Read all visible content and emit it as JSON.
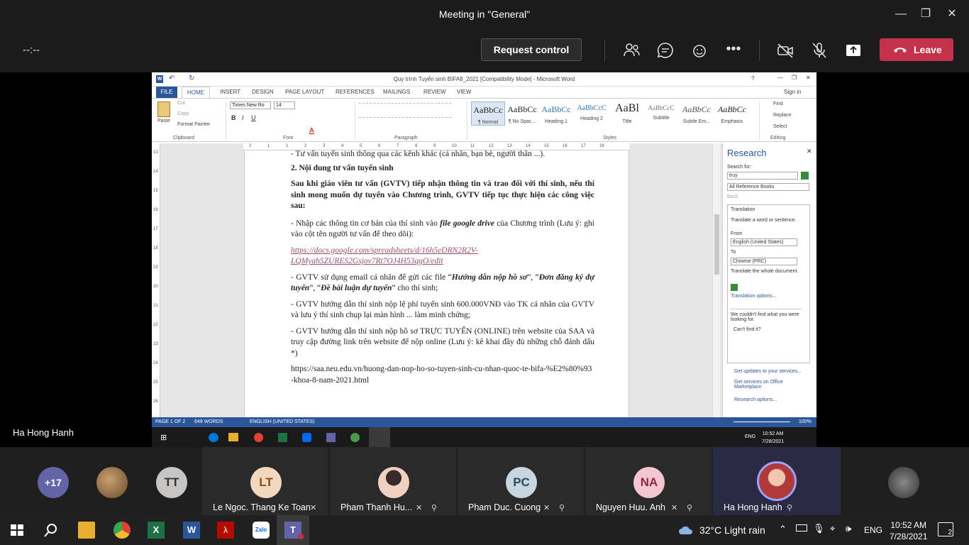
{
  "window": {
    "title": "Meeting in \"General\""
  },
  "toolbar": {
    "timer": "--:--",
    "request_control": "Request control",
    "leave": "Leave"
  },
  "presenter": {
    "name": "Ha Hong Hanh"
  },
  "word": {
    "title": "Quy trình Tuyển sinh BIFA8_2021 [Compatibility Mode] - Microsoft Word",
    "signin": "Sign in",
    "tabs": [
      "FILE",
      "HOME",
      "INSERT",
      "DESIGN",
      "PAGE LAYOUT",
      "REFERENCES",
      "MAILINGS",
      "REVIEW",
      "VIEW"
    ],
    "ribbon": {
      "clipboard": {
        "paste": "Paste",
        "cut": "Cut",
        "copy": "Copy",
        "format_painter": "Format Painter",
        "group": "Clipboard"
      },
      "font": {
        "name": "Times New Ro",
        "size": "14",
        "group": "Font"
      },
      "paragraph": {
        "group": "Paragraph"
      },
      "styles": {
        "group": "Styles",
        "items": [
          {
            "sample": "AaBbCc",
            "name": "¶ Normal"
          },
          {
            "sample": "AaBbCc",
            "name": "¶ No Spac..."
          },
          {
            "sample": "AaBbCc",
            "name": "Heading 1"
          },
          {
            "sample": "AaBbCcC",
            "name": "Heading 2"
          },
          {
            "sample": "AaBl",
            "name": "Title"
          },
          {
            "sample": "AaBbCcC",
            "name": "Subtitle"
          },
          {
            "sample": "AaBbCc",
            "name": "Subtle Em..."
          },
          {
            "sample": "AaBbCc",
            "name": "Emphasis"
          }
        ]
      },
      "editing": {
        "find": "Find",
        "replace": "Replace",
        "select": "Select",
        "group": "Editing"
      }
    },
    "ruler_marks": [
      "2",
      "1",
      "1",
      "2",
      "3",
      "4",
      "5",
      "6",
      "7",
      "8",
      "9",
      "10",
      "11",
      "12",
      "13",
      "14",
      "15",
      "16",
      "17",
      "18"
    ],
    "vruler_marks": [
      "13",
      "14",
      "15",
      "16",
      "17",
      "18",
      "19",
      "20",
      "21",
      "22",
      "23",
      "24",
      "25",
      "26"
    ],
    "doc": {
      "line0": "- Tư vấn tuyển sinh thông qua các kênh khác (cá nhân, bạn bè, người thân ...).",
      "heading": "2. Nội dung tư vấn tuyển sinh",
      "intro": "Sau khi giáo viên tư vấn (GVTV) tiếp nhận thông tin và trao đổi với thí sinh, nếu thí sinh mong muốn dự tuyển vào Chương trình, GVTV tiếp tục thực hiện các công việc sau:",
      "p1a": "- Nhập các thông tin cơ bản của thí sinh vào ",
      "p1b": "file google drive",
      "p1c": " của Chương trình (Lưu ý: ghi vào cột tên người tư vấn để theo dõi):",
      "link1": "https://docs.google.com/spreadsheets/d/16h5eDRN2R2V-LQMyah5ZURES2Gsjov7Rt7OJ4H53qgO/edit",
      "p2a": "- GVTV sử dụng email cá nhân để gửi các file “",
      "p2b": "Hướng dẫn nộp hồ sơ",
      "p2c": "”, “",
      "p2d": "Đơn đăng ký dự tuyển",
      "p2e": "”, “",
      "p2f": "Đề bài luận dự tuyển",
      "p2g": "” cho thí sinh;",
      "p3": "- GVTV hướng dẫn thí sinh nộp lệ phí tuyển sinh 600.000VNĐ vào TK cá nhân của GVTV và lưu ý thí sinh chụp lại màn hình ... làm minh chứng;",
      "p4": "- GVTV hướng dẫn thí sinh nộp hồ sơ TRỰC TUYẾN (ONLINE) trên website của SAA và truy cập đường link trên website để nộp online (Lưu ý: kê khai đầy đủ những chỗ đánh dấu *)",
      "link2": "https://saa.neu.edu.vn/huong-dan-nop-ho-so-tuyen-sinh-cu-nhan-quoc-te-bifa-%E2%80%93-khoa-8-nam-2021.html"
    },
    "research": {
      "title": "Research",
      "search_for": "Search for:",
      "query": "truy",
      "source": "All Reference Books",
      "back": "Back",
      "translation": "Translation",
      "translate_hint": "Translate a word or sentence.",
      "from": "From",
      "from_lang": "English (United States)",
      "to": "To",
      "to_lang": "Chinese (PRC)",
      "translate_doc": "Translate the whole document.",
      "options": "Translation options...",
      "not_found": "We couldn't find what you were looking for.",
      "cant_find": "Can't find it?",
      "updates": "Get updates to your services...",
      "services": "Get services on Office Marketplace",
      "research_options": "Research options..."
    },
    "status": {
      "page": "PAGE 1 OF 2",
      "words": "649 WORDS",
      "language": "ENGLISH (UNITED STATES)",
      "zoom": "100%"
    },
    "taskbar": {
      "lang": "ENG",
      "time": "10:52 AM",
      "date": "7/28/2021"
    }
  },
  "participants": [
    {
      "initials": "+17",
      "color": "#6264a7"
    },
    {
      "initials": "",
      "color": "#7a5a3a"
    },
    {
      "initials": "TT",
      "color": "#c8c6c4"
    },
    {
      "initials": "LT",
      "color": "#f3d8c0",
      "name": "Le Ngoc. Thang Ke Toan"
    },
    {
      "initials": "",
      "color": "#e8c8b8",
      "name": "Pham Thanh Hu..."
    },
    {
      "initials": "PC",
      "color": "#c8d6e0",
      "name": "Pham Duc. Cuong"
    },
    {
      "initials": "NA",
      "color": "#f4c6d2",
      "name": "Nguyen Huu. Anh"
    },
    {
      "initials": "",
      "color": "#b03a3a",
      "name": "Ha Hong Hanh"
    },
    {
      "initials": "",
      "color": "#555555"
    }
  ],
  "taskbar": {
    "weather": "32°C  Light rain",
    "lang": "ENG",
    "time": "10:52 AM",
    "date": "7/28/2021",
    "notifications": "2"
  }
}
